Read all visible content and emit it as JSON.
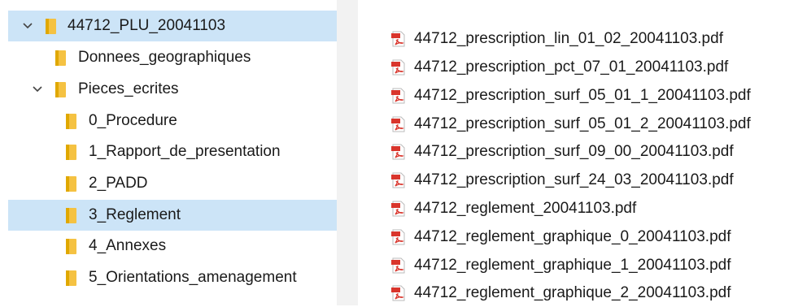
{
  "tree": {
    "items": [
      {
        "label": "44712_PLU_20041103",
        "expanded": true,
        "selected": false,
        "level": 0,
        "has_chevron": true
      },
      {
        "label": "Donnees_geographiques",
        "expanded": false,
        "selected": false,
        "level": 1,
        "has_chevron": false
      },
      {
        "label": "Pieces_ecrites",
        "expanded": true,
        "selected": false,
        "level": 1,
        "has_chevron": true
      },
      {
        "label": "0_Procedure",
        "expanded": false,
        "selected": false,
        "level": 2,
        "has_chevron": false
      },
      {
        "label": "1_Rapport_de_presentation",
        "expanded": false,
        "selected": false,
        "level": 2,
        "has_chevron": false
      },
      {
        "label": "2_PADD",
        "expanded": false,
        "selected": false,
        "level": 2,
        "has_chevron": false
      },
      {
        "label": "3_Reglement",
        "expanded": false,
        "selected": true,
        "level": 2,
        "has_chevron": false
      },
      {
        "label": "4_Annexes",
        "expanded": false,
        "selected": false,
        "level": 2,
        "has_chevron": false
      },
      {
        "label": "5_Orientations_amenagement",
        "expanded": false,
        "selected": false,
        "level": 2,
        "has_chevron": false
      }
    ]
  },
  "files": {
    "items": [
      {
        "label": "44712_prescription_lin_01_02_20041103.pdf",
        "icon": "pdf-icon"
      },
      {
        "label": "44712_prescription_pct_07_01_20041103.pdf",
        "icon": "pdf-icon"
      },
      {
        "label": "44712_prescription_surf_05_01_1_20041103.pdf",
        "icon": "pdf-icon"
      },
      {
        "label": "44712_prescription_surf_05_01_2_20041103.pdf",
        "icon": "pdf-icon"
      },
      {
        "label": "44712_prescription_surf_09_00_20041103.pdf",
        "icon": "pdf-icon"
      },
      {
        "label": "44712_prescription_surf_24_03_20041103.pdf",
        "icon": "pdf-icon"
      },
      {
        "label": "44712_reglement_20041103.pdf",
        "icon": "pdf-icon"
      },
      {
        "label": "44712_reglement_graphique_0_20041103.pdf",
        "icon": "pdf-icon"
      },
      {
        "label": "44712_reglement_graphique_1_20041103.pdf",
        "icon": "pdf-icon"
      },
      {
        "label": "44712_reglement_graphique_2_20041103.pdf",
        "icon": "pdf-icon"
      }
    ]
  },
  "colors": {
    "selected_bg": "#cce4f7",
    "folder_yellow": "#f5c242",
    "pdf_red": "#d9352c"
  }
}
